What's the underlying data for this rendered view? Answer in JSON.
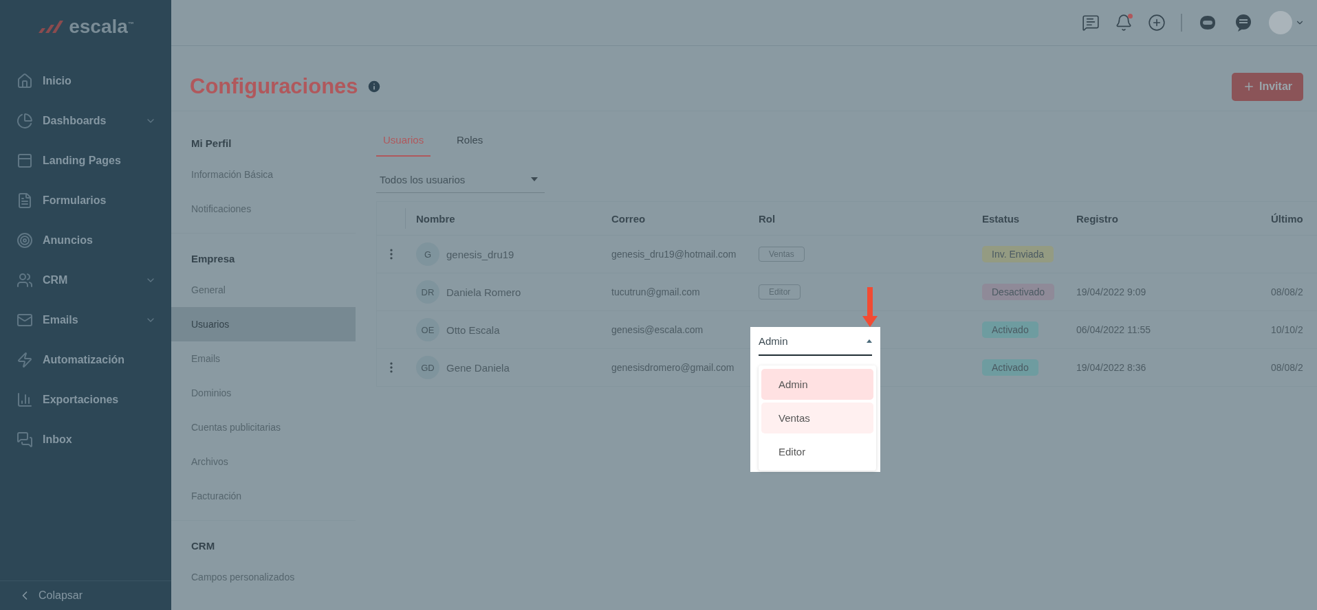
{
  "sidebar": {
    "logo_text": "escala$^{™}$",
    "items": [
      {
        "label": "Inicio",
        "expandable": false
      },
      {
        "label": "Dashboards",
        "expandable": true
      },
      {
        "label": "Landing Pages",
        "expandable": false
      },
      {
        "label": "Formularios",
        "expandable": false
      },
      {
        "label": "Anuncios",
        "expandable": false
      },
      {
        "label": "CRM",
        "expandable": true
      },
      {
        "label": "Emails",
        "expandable": true
      },
      {
        "label": "Automatización",
        "expandable": false
      },
      {
        "label": "Exportaciones",
        "expandable": false
      },
      {
        "label": "Inbox",
        "expandable": false
      }
    ],
    "collapse_label": "Colapsar"
  },
  "topbar": {
    "notification_dot": true
  },
  "page": {
    "title": "Configuraciones",
    "invite_button": "Invitar"
  },
  "settings_nav": [
    {
      "title": "Mi Perfil",
      "items": [
        {
          "label": "Información Básica",
          "selected": false
        },
        {
          "label": "Notificaciones",
          "selected": false
        }
      ]
    },
    {
      "title": "Empresa",
      "items": [
        {
          "label": "General",
          "selected": false
        },
        {
          "label": "Usuarios",
          "selected": true
        },
        {
          "label": "Emails",
          "selected": false
        },
        {
          "label": "Dominios",
          "selected": false
        },
        {
          "label": "Cuentas publicitarias",
          "selected": false
        },
        {
          "label": "Archivos",
          "selected": false
        },
        {
          "label": "Facturación",
          "selected": false
        }
      ]
    },
    {
      "title": "CRM",
      "items": [
        {
          "label": "Campos personalizados",
          "selected": false
        }
      ]
    }
  ],
  "tabs": [
    {
      "label": "Usuarios",
      "selected": true
    },
    {
      "label": "Roles",
      "selected": false
    }
  ],
  "filter": {
    "value": "Todos los usuarios"
  },
  "table": {
    "columns": [
      "Nombre",
      "Correo",
      "Rol",
      "Estatus",
      "Registro",
      "Último"
    ],
    "rows": [
      {
        "has_menu": true,
        "initials": "G",
        "name": "genesis_dru19",
        "email": "genesis_dru19@hotmail.com",
        "role": "Ventas",
        "status": "Inv. Enviada",
        "color": "#949b82"
      },
      {
        "has_menu": false,
        "initials": "DR",
        "name": "Daniela Romero",
        "email": "tucutrun@gmail.com",
        "role": "Editor",
        "status": "Desactivado",
        "color": "#8f8a98",
        "registered": "19/04/2022 9:09",
        "last": "08/08/2"
      },
      {
        "has_menu": false,
        "initials": "OE",
        "name": "Otto Escala",
        "email": "genesis@escala.com",
        "role_dropdown": {
          "value": "Admin",
          "options": [
            {
              "label": "Admin",
              "selected": true,
              "highlighted": false
            },
            {
              "label": "Ventas",
              "selected": false,
              "highlighted": true
            },
            {
              "label": "Editor",
              "selected": false,
              "highlighted": false
            }
          ]
        },
        "status": "Activado",
        "color": "#6e9ca0",
        "registered": "06/04/2022 11:55",
        "last": "10/10/2"
      },
      {
        "has_menu": true,
        "initials": "GD",
        "name": "Gene Daniela",
        "email": "genesisdromero@gmail.com",
        "status": "Activado",
        "color": "#6e9ca0",
        "registered": "19/04/2022 8:36",
        "last": "08/08/2"
      }
    ]
  }
}
